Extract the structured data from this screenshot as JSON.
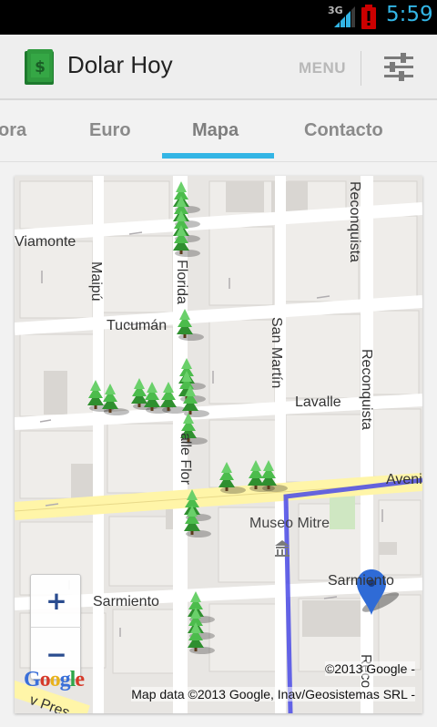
{
  "status_bar": {
    "network": "3G",
    "time": "5:59"
  },
  "action_bar": {
    "title": "Dolar Hoy",
    "menu_label": "MENU"
  },
  "tabs": [
    {
      "label": "ora",
      "active": false
    },
    {
      "label": "Euro",
      "active": false
    },
    {
      "label": "Mapa",
      "active": true
    },
    {
      "label": "Contacto",
      "active": false
    }
  ],
  "map": {
    "streets": {
      "viamonte": "Viamonte",
      "maipu": "Maipú",
      "florida": "Florida",
      "tucuman": "Tucumán",
      "san_martin": "San Martín",
      "lavalle": "Lavalle",
      "reconquista_top": "Reconquista",
      "reconquista_mid": "Reconquista",
      "calle_florida": "alle Flor",
      "avenida": "Avenid",
      "sarmiento_left": "Sarmiento",
      "sarmiento_right": "Sarmiento",
      "reconquista_bottom": "Reco",
      "presidente": "v Pres"
    },
    "poi": "Museo Mitre",
    "zoom_in": "+",
    "zoom_out": "−",
    "google_logo": "Google",
    "attribution_copyright": "©2013 Google -",
    "attribution_data": "Map data ©2013 Google, Inav/Geosistemas SRL -"
  },
  "colors": {
    "accent": "#33b5e5",
    "route": "#4a4ae6",
    "avenue": "#fff5a8",
    "tree": "#3aa53a"
  }
}
